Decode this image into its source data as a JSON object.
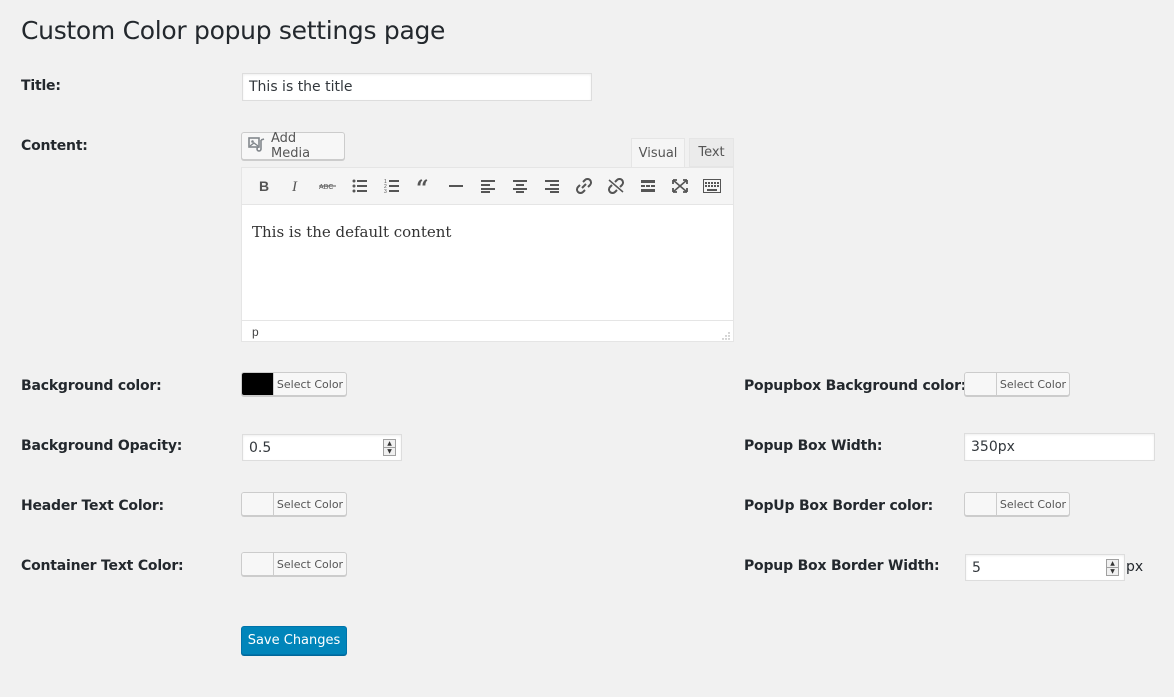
{
  "page": {
    "title": "Custom Color popup settings page"
  },
  "fields": {
    "title": {
      "label": "Title:",
      "value": "This is the title"
    },
    "content": {
      "label": "Content:"
    },
    "bg_color": {
      "label": "Background color:",
      "button": "Select Color",
      "swatch_color": "#000000"
    },
    "bg_opacity": {
      "label": "Background Opacity:",
      "value": "0.5"
    },
    "header_text_color": {
      "label": "Header Text Color:",
      "button": "Select Color"
    },
    "container_text_color": {
      "label": "Container Text Color:",
      "button": "Select Color"
    },
    "popup_bg_color": {
      "label": "Popupbox Background color:",
      "button": "Select Color"
    },
    "popup_width": {
      "label": "Popup Box Width:",
      "value": "350px"
    },
    "popup_border_color": {
      "label": "PopUp Box Border color:",
      "button": "Select Color"
    },
    "popup_border_width": {
      "label": "Popup Box Border Width:",
      "value": "5",
      "unit": "px"
    }
  },
  "editor": {
    "add_media": "Add Media",
    "tabs": {
      "visual": "Visual",
      "text": "Text"
    },
    "body": "This is the default content",
    "status_path": "p",
    "toolbar_icons": [
      "bold-icon",
      "italic-icon",
      "strikethrough-icon",
      "bullet-list-icon",
      "numbered-list-icon",
      "blockquote-icon",
      "horizontal-rule-icon",
      "align-left-icon",
      "align-center-icon",
      "align-right-icon",
      "link-icon",
      "unlink-icon",
      "read-more-icon",
      "fullscreen-icon",
      "toolbar-toggle-icon"
    ]
  },
  "actions": {
    "save": "Save Changes"
  },
  "colors": {
    "primary": "#0085ba",
    "background": "#f1f1f1"
  }
}
